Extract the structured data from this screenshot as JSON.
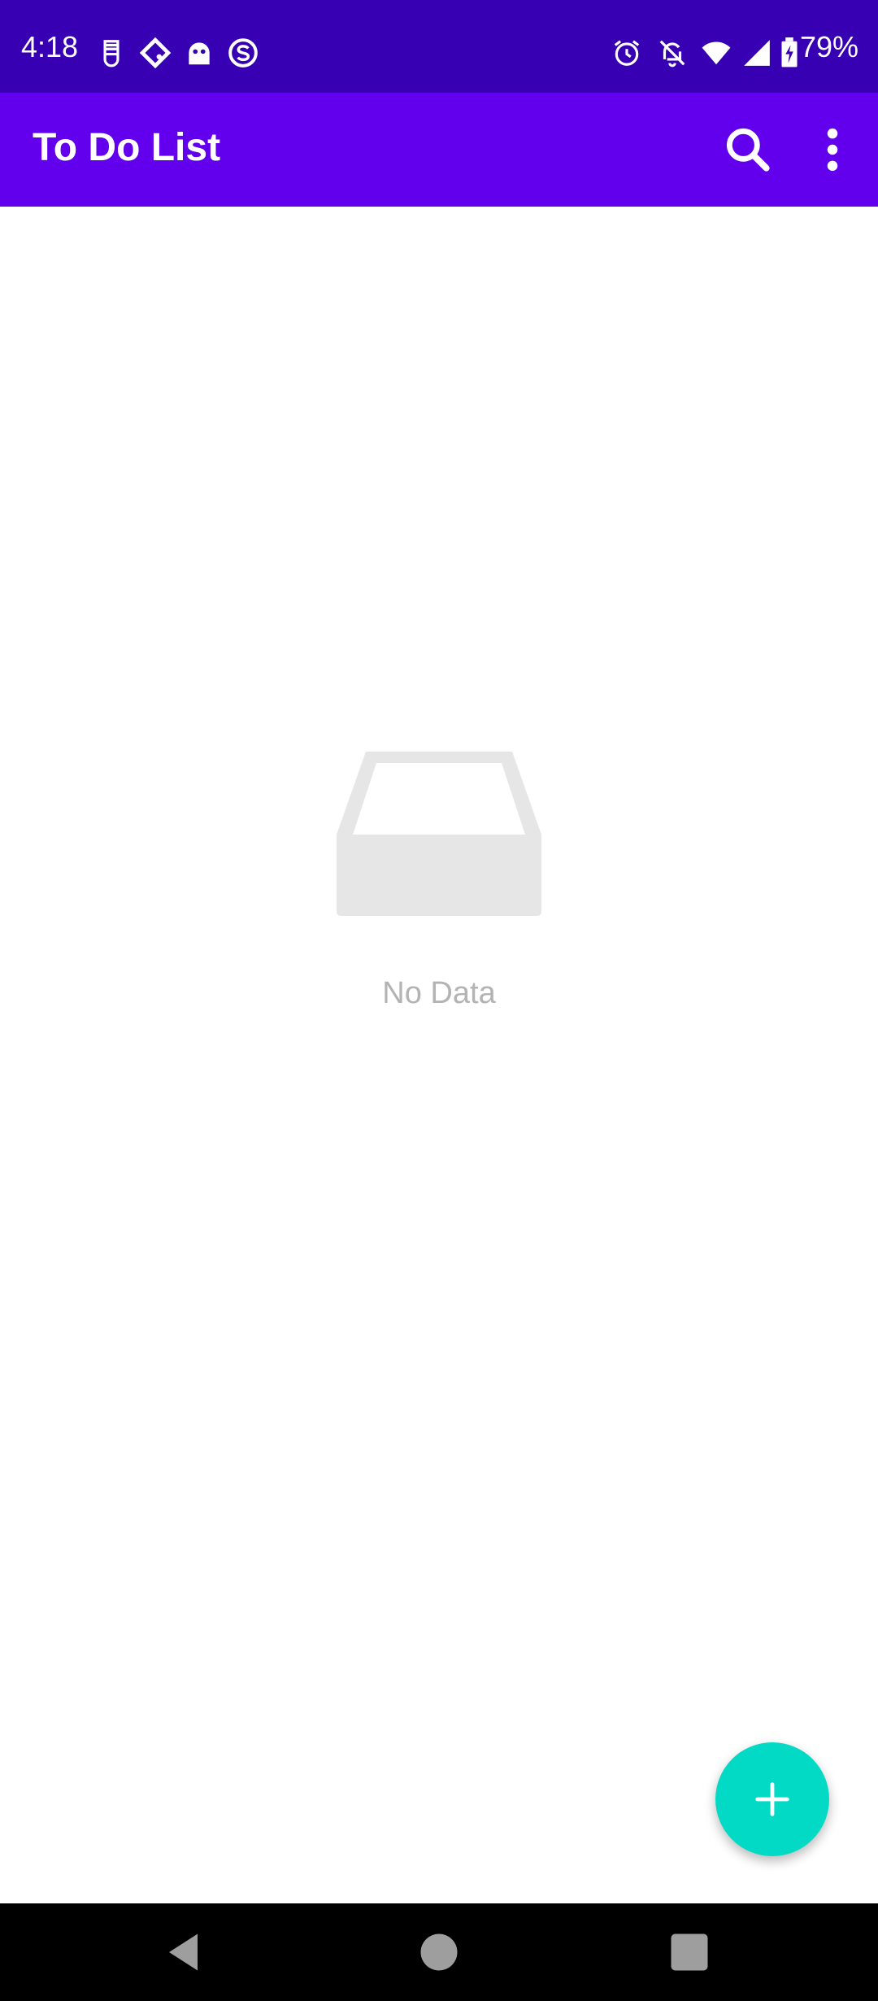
{
  "status_bar": {
    "time": "4:18",
    "battery": "79%",
    "icons": [
      "sim-icon",
      "diamond-app-icon",
      "ghost-app-icon",
      "s-app-icon",
      "alarm-icon",
      "notifications-off-icon",
      "wifi-icon",
      "signal-icon",
      "battery-charging-icon"
    ]
  },
  "app_bar": {
    "title": "To Do List",
    "actions": [
      "search-icon",
      "more-vert-icon"
    ]
  },
  "empty_state": {
    "icon": "inbox-tray-icon",
    "text": "No Data"
  },
  "fab": {
    "icon": "add-icon"
  },
  "nav_bar": {
    "buttons": [
      "back-icon",
      "home-icon",
      "recents-icon"
    ]
  },
  "colors": {
    "status_bar": "#3700b3",
    "app_bar": "#6200ee",
    "fab": "#03dac5",
    "empty_text": "#b3b3b3",
    "empty_icon": "#e6e6e6",
    "nav_bar": "#000000"
  }
}
